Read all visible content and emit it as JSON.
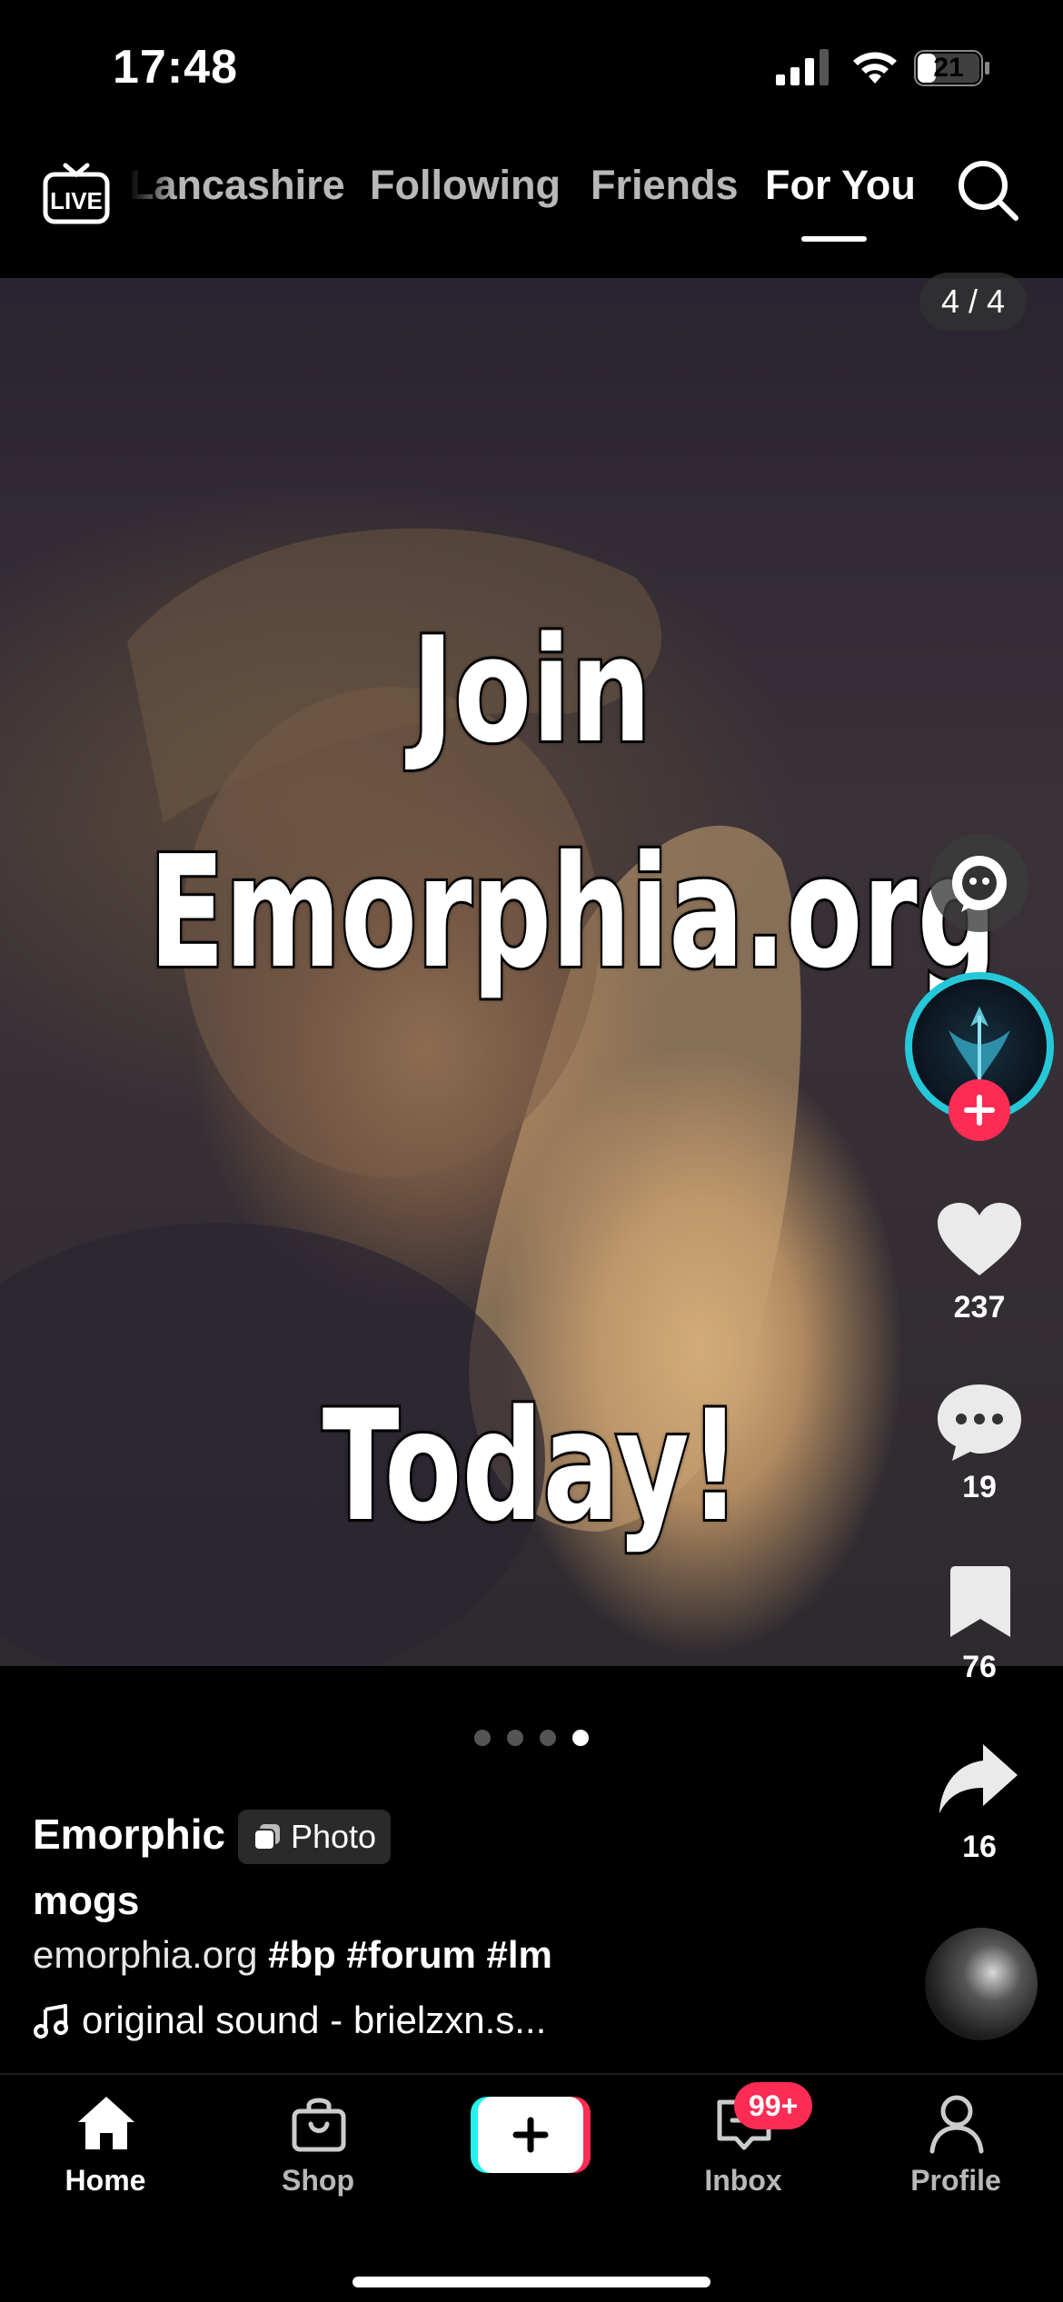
{
  "status_bar": {
    "time": "17:48",
    "battery_level": "21"
  },
  "top_nav": {
    "tabs": [
      {
        "label": "Lancashire",
        "active": false
      },
      {
        "label": "Following",
        "active": false
      },
      {
        "label": "Friends",
        "active": false
      },
      {
        "label": "For You",
        "active": true
      }
    ],
    "live_icon_text": "LIVE"
  },
  "media": {
    "counter": "4 / 4",
    "overlay_text": [
      "Join",
      "Emorphia.org",
      "Today!"
    ],
    "page_total": 4,
    "page_current": 4
  },
  "rail": {
    "likes": "237",
    "comments": "19",
    "saves": "76",
    "shares": "16"
  },
  "post": {
    "author": "Emorphic",
    "badge": "Photo",
    "title": "mogs",
    "description_plain": "emorphia.org",
    "hashtags": "#bp #forum #lm",
    "sound": "original sound - brielzxn.s..."
  },
  "bottom_nav": {
    "items": [
      {
        "label": "Home",
        "active": true
      },
      {
        "label": "Shop",
        "active": false
      },
      {
        "label": "Inbox",
        "active": false
      },
      {
        "label": "Profile",
        "active": false
      }
    ],
    "inbox_badge": "99+"
  },
  "colors": {
    "accent": "#fe2c55",
    "cyan": "#25c8d8",
    "background": "#000000"
  }
}
